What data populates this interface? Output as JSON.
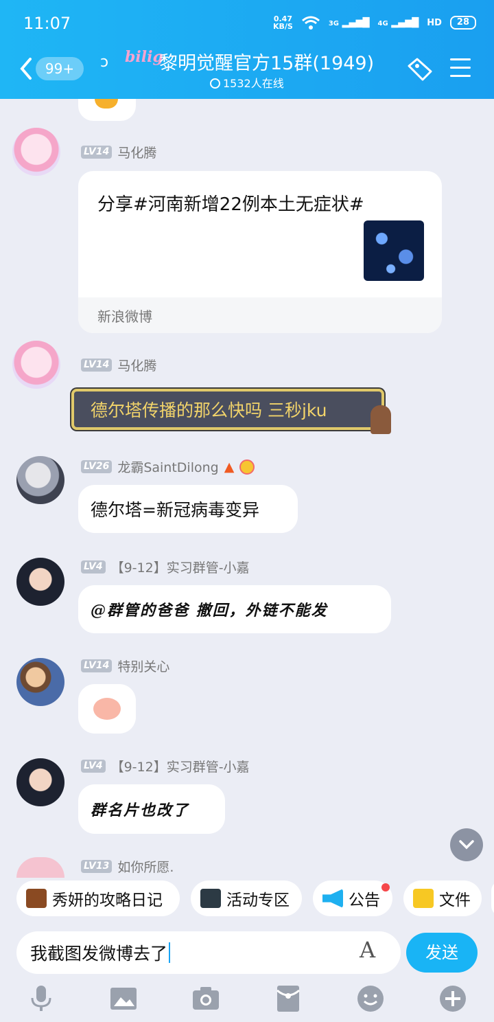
{
  "status_bar": {
    "time": "11:07",
    "net_speed_top": "0.47",
    "net_speed_bottom": "KB/S",
    "sig1": "3G",
    "sig2": "4G",
    "hd": "HD",
    "battery": "28"
  },
  "header": {
    "badge": "99+",
    "logo_text": "bilig",
    "title": "黎明觉醒官方15群(1949)",
    "online": "1532人在线"
  },
  "messages": [
    {
      "lv": "LV14",
      "name": "马化腾",
      "share_text": "分享#河南新增22例本土无症状#",
      "share_source": "新浪微博"
    },
    {
      "lv": "LV14",
      "name": "马化腾",
      "text": "德尔塔传播的那么快吗 三秒jku"
    },
    {
      "lv": "LV26",
      "name": "龙霸SaintDilong",
      "text": "德尔塔=新冠病毒变异"
    },
    {
      "lv": "LV4",
      "name": "【9-12】实习群管-小嘉",
      "text": "@群管的爸爸 撤回，外链不能发"
    },
    {
      "lv": "LV14",
      "name": "特别关心",
      "text": "🐷"
    },
    {
      "lv": "LV4",
      "name": "【9-12】实习群管-小嘉",
      "text": "群名片也改了"
    },
    {
      "lv": "LV13",
      "name": "如你所愿."
    }
  ],
  "quickbar": [
    "秀妍的攻略日记",
    "活动专区",
    "公告",
    "文件"
  ],
  "input": {
    "value": "我截图发微博去了",
    "send_label": "发送"
  }
}
